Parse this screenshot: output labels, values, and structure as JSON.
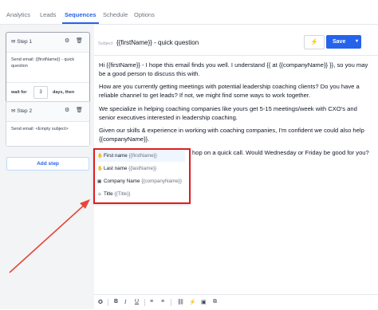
{
  "tabs": [
    "Analytics",
    "Leads",
    "Sequences",
    "Schedule",
    "Options"
  ],
  "steps": [
    {
      "label": "Step 1",
      "body": "Send email: {{firstName}} - quick question",
      "wait_label": "wait for",
      "wait_value": "3",
      "wait_unit": "days, then"
    },
    {
      "label": "Step 2",
      "body": "Send email: <Empty subject>"
    }
  ],
  "add_step_label": "Add step",
  "editor": {
    "subject_label": "Subject",
    "subject_value": "{{firstName}} - quick question",
    "save_label": "Save",
    "paragraphs": [
      "Hi {{firstName}} - I hope this email finds you well. I understand {{ at {{companyName}} }}, so you may be a good person to discuss this with.",
      "How are you currently getting meetings with potential leadership coaching clients? Do you have a reliable channel to get leads? If not, we might find some ways to work together.",
      "We specialize in helping coaching companies like yours get 5-15 meetings/week with CXO's and senior executives interested in leadership coaching.",
      "Given our skills & experience in working with coaching companies, I'm confident we could also help {{companyName}}."
    ],
    "partial_line": "hop on a quick call. Would Wednesday or Friday be good for you?"
  },
  "variables_menu": [
    {
      "label": "First name",
      "var": "{{firstName}}",
      "icon": "hand-icon"
    },
    {
      "label": "Last name",
      "var": "{{lastName}}",
      "icon": "hand-icon"
    },
    {
      "label": "Company Name",
      "var": "{{companyName}}",
      "icon": "building-icon"
    },
    {
      "label": "Title",
      "var": "{{Title}}",
      "icon": "user-icon"
    }
  ],
  "colors": {
    "accent": "#2563eb",
    "highlight_border": "#e11d22",
    "arrow": "#e5483a"
  }
}
